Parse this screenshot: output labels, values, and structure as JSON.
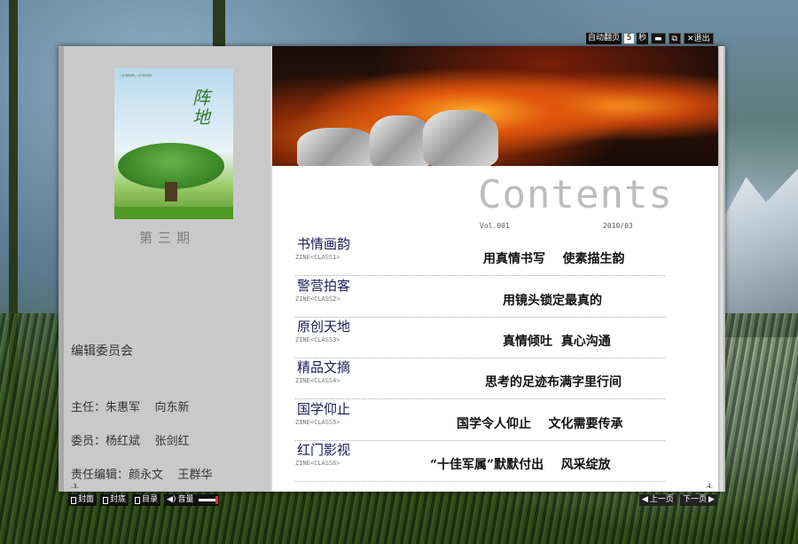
{
  "controls": {
    "auto_flip_label": "自动翻页",
    "auto_flip_seconds": "5",
    "seconds_unit": "秒",
    "minimize": "▬",
    "restore": "⧉",
    "exit_label": "退出"
  },
  "left_page": {
    "cover": {
      "calligraphy": "阵地",
      "small_text": "公安消防部队 公安消防部队"
    },
    "issue": "第三期",
    "committee_title": "编辑委员会",
    "members": [
      "主任：朱惠军    向东新",
      "委员：杨红斌    张剑红",
      "责任编辑：颜永文    王群华"
    ],
    "page_number": ".3."
  },
  "right_page": {
    "title": "Contents",
    "vol": "Vol.001",
    "date": "2010/03",
    "entries": [
      {
        "category": "书情画韵",
        "code": "ZINE<CLASS1>",
        "title": "用真情书写    使素描生韵"
      },
      {
        "category": "警营拍客",
        "code": "ZINE<CLASS2>",
        "title": "用镜头锁定最真的"
      },
      {
        "category": "原创天地",
        "code": "ZINE<CLASS3>",
        "title": "真情倾吐  真心沟通"
      },
      {
        "category": "精品文摘",
        "code": "ZINE<CLASS4>",
        "title": "思考的足迹布满字里行间"
      },
      {
        "category": "国学仰止",
        "code": "ZINE<CLASS5>",
        "title": "国学令人仰止    文化需要传承"
      },
      {
        "category": "红门影视",
        "code": "ZINE<CLASS6>",
        "title": "“十佳军属”默默付出    风采绽放"
      }
    ],
    "page_number": ".4."
  },
  "bottom_bar": {
    "front_cover": "封面",
    "back_cover": "封底",
    "toc": "目录",
    "volume": "音量",
    "prev": "上一页",
    "next": "下一页"
  },
  "colors": {
    "category_text": "#1a1a5a",
    "contents_title": "#bdbdbd",
    "left_page_bg": "#c9c9c9"
  }
}
